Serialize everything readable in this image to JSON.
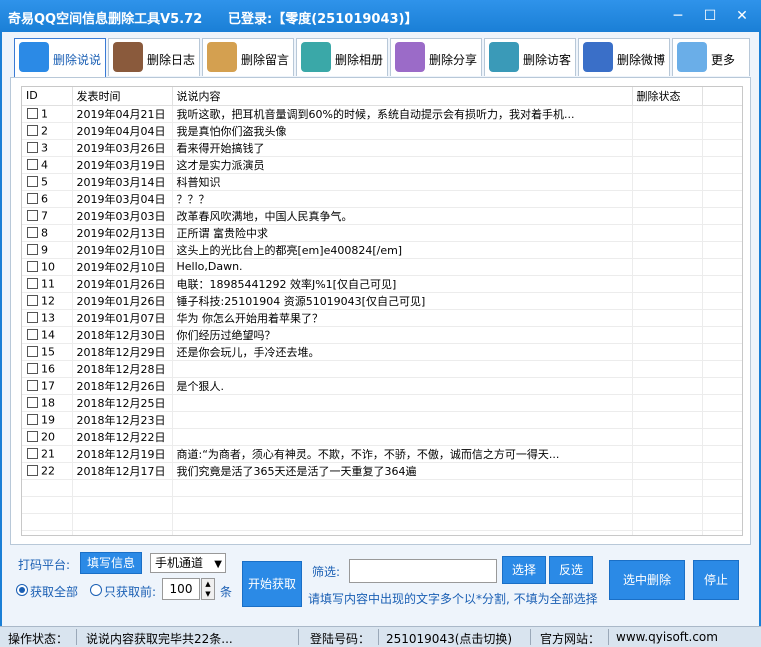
{
  "titlebar": {
    "app_title": "奇易QQ空间信息删除工具V5.72",
    "login_status": "已登录:【零度(251019043)】"
  },
  "tabs": [
    {
      "label": "删除说说",
      "icon": "chat-bubble-icon",
      "color": "#2b8ae6",
      "active": true
    },
    {
      "label": "删除日志",
      "icon": "notebook-icon",
      "color": "#8a5a3c",
      "active": false
    },
    {
      "label": "删除留言",
      "icon": "edit-note-icon",
      "color": "#d4a050",
      "active": false
    },
    {
      "label": "删除相册",
      "icon": "picture-icon",
      "color": "#3aa8a8",
      "active": false
    },
    {
      "label": "删除分享",
      "icon": "share-icon",
      "color": "#9b6bc8",
      "active": false
    },
    {
      "label": "删除访客",
      "icon": "visitor-icon",
      "color": "#3a9ab8",
      "active": false
    },
    {
      "label": "删除微博",
      "icon": "weibo-icon",
      "color": "#3a6fc8",
      "active": false
    },
    {
      "label": "更多",
      "icon": "people-icon",
      "color": "#6aaee8",
      "active": false
    }
  ],
  "table": {
    "columns": [
      "ID",
      "发表时间",
      "说说内容",
      "删除状态"
    ],
    "rows": [
      {
        "id": "1",
        "time": "2019年04月21日",
        "content": "我听这歌，把耳机音量调到60%的时候，系统自动提示会有损听力，我对着手机...",
        "status": ""
      },
      {
        "id": "2",
        "time": "2019年04月04日",
        "content": "我是真怕你们盗我头像",
        "status": ""
      },
      {
        "id": "3",
        "time": "2019年03月26日",
        "content": "看来得开始搞钱了",
        "status": ""
      },
      {
        "id": "4",
        "time": "2019年03月19日",
        "content": "这才是实力派演员",
        "status": ""
      },
      {
        "id": "5",
        "time": "2019年03月14日",
        "content": "科普知识",
        "status": ""
      },
      {
        "id": "6",
        "time": "2019年03月04日",
        "content": "？？？",
        "status": ""
      },
      {
        "id": "7",
        "time": "2019年03月03日",
        "content": "改革春风吹满地，中国人民真争气。",
        "status": ""
      },
      {
        "id": "8",
        "time": "2019年02月13日",
        "content": "正所谓 富贵险中求",
        "status": ""
      },
      {
        "id": "9",
        "time": "2019年02月10日",
        "content": "这头上的光比台上的都亮[em]e400824[/em]",
        "status": ""
      },
      {
        "id": "10",
        "time": "2019年02月10日",
        "content": "Hello,Dawn.",
        "status": ""
      },
      {
        "id": "11",
        "time": "2019年01月26日",
        "content": "电联：18985441292  效率J%1[仅自己可见]",
        "status": ""
      },
      {
        "id": "12",
        "time": "2019年01月26日",
        "content": "锤子科技:25101904 资源51019043[仅自己可见]",
        "status": ""
      },
      {
        "id": "13",
        "time": "2019年01月07日",
        "content": "华为 你怎么开始用着苹果了？",
        "status": ""
      },
      {
        "id": "14",
        "time": "2018年12月30日",
        "content": "你们经历过绝望吗？",
        "status": ""
      },
      {
        "id": "15",
        "time": "2018年12月29日",
        "content": "还是你会玩儿，手冷还去堆。",
        "status": ""
      },
      {
        "id": "16",
        "time": "2018年12月28日",
        "content": "",
        "status": ""
      },
      {
        "id": "17",
        "time": "2018年12月26日",
        "content": "是个狠人.",
        "status": ""
      },
      {
        "id": "18",
        "time": "2018年12月25日",
        "content": "",
        "status": ""
      },
      {
        "id": "19",
        "time": "2018年12月23日",
        "content": "",
        "status": ""
      },
      {
        "id": "20",
        "time": "2018年12月22日",
        "content": "",
        "status": ""
      },
      {
        "id": "21",
        "time": "2018年12月19日",
        "content": "商道:“为商者，须心有神灵。不欺，不诈，不骄，不傲，诚而信之方可一得天...",
        "status": ""
      },
      {
        "id": "22",
        "time": "2018年12月17日",
        "content": "我们究竟是活了365天还是活了一天重复了364遍",
        "status": ""
      }
    ],
    "empty_rows": 4
  },
  "controls": {
    "platform_label": "打码平台:",
    "fill_info_label": "填写信息",
    "channel_value": "手机通道",
    "get_all_label": "获取全部",
    "only_get_label": "只获取前:",
    "count_value": "100",
    "count_unit": "条",
    "start_label": "开始获取",
    "filter_label": "筛选:",
    "filter_value": "",
    "select_label": "选择",
    "invert_label": "反选",
    "filter_hint": "请填写内容中出现的文字多个以*分割, 不填为全部选择",
    "delete_selected_label": "选中删除",
    "stop_label": "停止"
  },
  "statusbar": {
    "op_status_label": "操作状态：",
    "op_status_value": "说说内容获取完毕共22条...",
    "login_label": "登陆号码：",
    "login_value": "251019043(点击切换)",
    "site_label": "官方网站：",
    "site_value": "www.qyisoft.com"
  }
}
